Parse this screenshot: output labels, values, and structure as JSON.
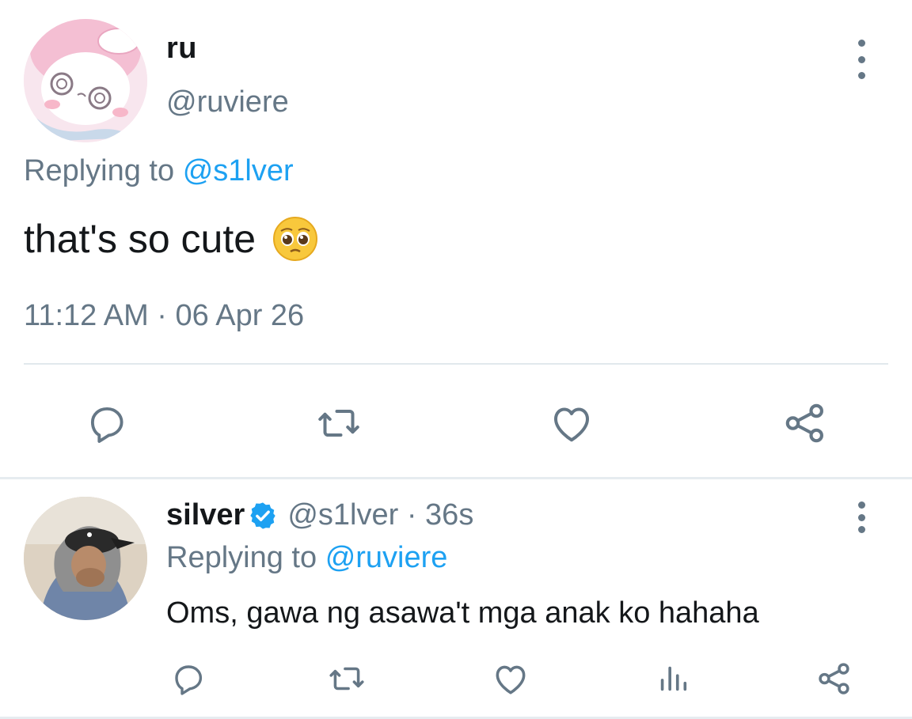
{
  "colors": {
    "accent": "#1da1f2",
    "secondary_text": "#657786",
    "icon": "#657786",
    "divider": "#e1e8ed"
  },
  "main_tweet": {
    "author_name": "ru",
    "author_handle": "@ruviere",
    "replying_prefix": "Replying to",
    "replying_handle": "@s1lver",
    "text": "that's so cute",
    "emoji": "pleading-face-emoji",
    "timestamp": "11:12 AM · 06 Apr 26",
    "actions": [
      "reply-icon",
      "retweet-icon",
      "like-icon",
      "share-icon"
    ]
  },
  "reply_tweet": {
    "author_name": "silver",
    "verified": true,
    "author_handle": "@s1lver",
    "time_sep": " · ",
    "time": "36s",
    "replying_prefix": "Replying to",
    "replying_handle": "@ruviere",
    "text": "Oms, gawa ng asawa't mga anak ko hahaha",
    "actions": [
      "reply-icon",
      "retweet-icon",
      "like-icon",
      "analytics-icon",
      "share-icon"
    ]
  }
}
